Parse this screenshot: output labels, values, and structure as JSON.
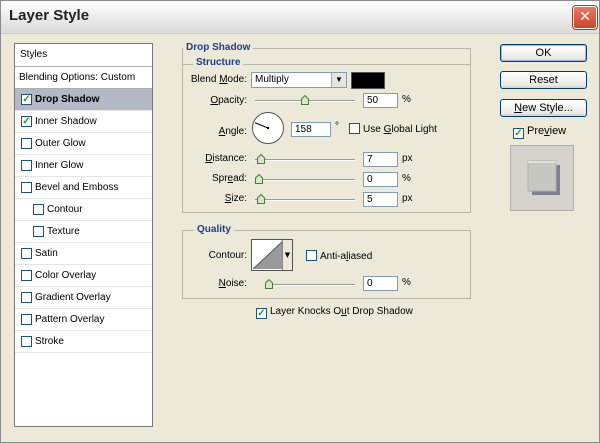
{
  "window": {
    "title": "Layer Style",
    "close_glyph": "✕"
  },
  "styles_panel": {
    "header": "Styles",
    "blending_options": "Blending Options: Custom",
    "items": [
      {
        "label": "Drop Shadow",
        "checked": true,
        "selected": true,
        "indent": false
      },
      {
        "label": "Inner Shadow",
        "checked": true,
        "selected": false,
        "indent": false
      },
      {
        "label": "Outer Glow",
        "checked": false,
        "selected": false,
        "indent": false
      },
      {
        "label": "Inner Glow",
        "checked": false,
        "selected": false,
        "indent": false
      },
      {
        "label": "Bevel and Emboss",
        "checked": false,
        "selected": false,
        "indent": false
      },
      {
        "label": "Contour",
        "checked": false,
        "selected": false,
        "indent": true
      },
      {
        "label": "Texture",
        "checked": false,
        "selected": false,
        "indent": true
      },
      {
        "label": "Satin",
        "checked": false,
        "selected": false,
        "indent": false
      },
      {
        "label": "Color Overlay",
        "checked": false,
        "selected": false,
        "indent": false
      },
      {
        "label": "Gradient Overlay",
        "checked": false,
        "selected": false,
        "indent": false
      },
      {
        "label": "Pattern Overlay",
        "checked": false,
        "selected": false,
        "indent": false
      },
      {
        "label": "Stroke",
        "checked": false,
        "selected": false,
        "indent": false
      }
    ]
  },
  "drop_shadow": {
    "section_title": "Drop Shadow",
    "structure_title": "Structure",
    "blend_mode": {
      "label_pre": "Blend ",
      "label_u": "M",
      "label_post": "ode:",
      "value": "Multiply",
      "color": "#000000"
    },
    "opacity": {
      "label_u": "O",
      "label_post": "pacity:",
      "value": "50",
      "unit": "%",
      "fraction": 0.5
    },
    "angle": {
      "label_u": "A",
      "label_post": "ngle:",
      "value": "158",
      "unit": "°",
      "degrees": 158
    },
    "use_global_light": {
      "label_pre": "Use ",
      "label_u": "G",
      "label_post": "lobal Light",
      "checked": false
    },
    "distance": {
      "label_u": "D",
      "label_post": "istance:",
      "value": "7",
      "unit": "px",
      "fraction": 0.02
    },
    "spread": {
      "label_pre": "Spr",
      "label_u": "e",
      "label_post": "ad:",
      "value": "0",
      "unit": "%",
      "fraction": 0.0
    },
    "size": {
      "label_u": "S",
      "label_post": "ize:",
      "value": "5",
      "unit": "px",
      "fraction": 0.02
    }
  },
  "quality": {
    "section_title": "Quality",
    "contour_label": "Contour:",
    "anti_aliased": {
      "label_pre": "Anti-a",
      "label_u": "l",
      "label_post": "iased",
      "checked": false
    },
    "noise": {
      "label_u": "N",
      "label_post": "oise:",
      "value": "0",
      "unit": "%",
      "fraction": 0.0
    }
  },
  "knockout": {
    "label_pre": "Layer Knocks O",
    "label_u": "u",
    "label_post": "t Drop Shadow",
    "checked": true
  },
  "buttons": {
    "ok": "OK",
    "reset": "Reset",
    "new_style_u": "N",
    "new_style_post": "ew Style...",
    "preview_pre": "Pre",
    "preview_u": "v",
    "preview_post": "iew",
    "preview_checked": true
  },
  "colors": {
    "accent_title": "#1d3f8c",
    "selected_row": "#b4b9c6",
    "check_green": "#21a121"
  }
}
